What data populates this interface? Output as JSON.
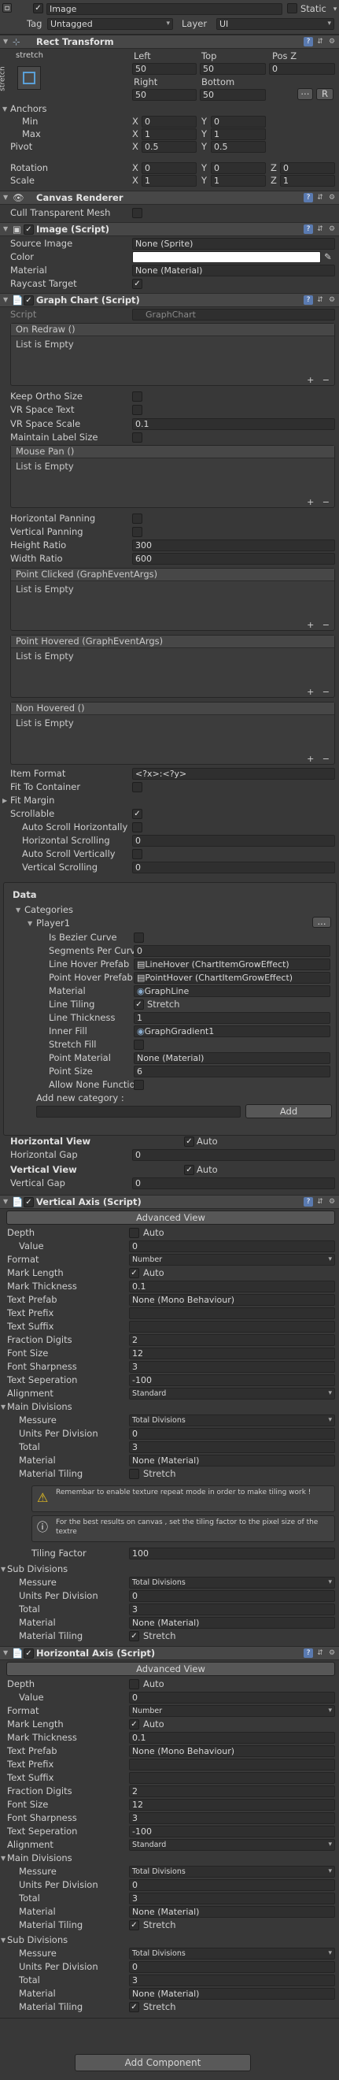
{
  "go": {
    "name": "Image",
    "static": "Static",
    "tag_label": "Tag",
    "tag": "Untagged",
    "layer_label": "Layer",
    "layer": "UI"
  },
  "rect": {
    "title": "Rect Transform",
    "stretch": "stretch",
    "left": "Left",
    "top": "Top",
    "posz": "Pos Z",
    "left_v": "50",
    "top_v": "50",
    "posz_v": "0",
    "right": "Right",
    "bottom": "Bottom",
    "right_v": "50",
    "bottom_v": "50",
    "r": "R",
    "anchors": "Anchors",
    "min": "Min",
    "max": "Max",
    "pivot": "Pivot",
    "x": "X",
    "y": "Y",
    "z": "Z",
    "min_x": "0",
    "min_y": "0",
    "max_x": "1",
    "max_y": "1",
    "piv_x": "0.5",
    "piv_y": "0.5",
    "rotation": "Rotation",
    "scale": "Scale",
    "rot_x": "0",
    "rot_y": "0",
    "rot_z": "0",
    "sc_x": "1",
    "sc_y": "1",
    "sc_z": "1"
  },
  "canvas": {
    "title": "Canvas Renderer",
    "cull": "Cull Transparent Mesh"
  },
  "image": {
    "title": "Image (Script)",
    "source": "Source Image",
    "source_v": "None (Sprite)",
    "color": "Color",
    "material": "Material",
    "material_v": "None (Material)",
    "raycast": "Raycast Target"
  },
  "graph": {
    "title": "Graph Chart (Script)",
    "script": "Script",
    "script_v": "GraphChart",
    "on_redraw": "On Redraw ()",
    "empty": "List is Empty",
    "keep_ortho": "Keep Ortho Size",
    "vr_text": "VR Space Text",
    "vr_scale": "VR Space Scale",
    "vr_scale_v": "0.1",
    "maintain": "Maintain Label Size",
    "mouse_pan": "Mouse Pan ()",
    "hpan": "Horizontal Panning",
    "vpan": "Vertical Panning",
    "height": "Height Ratio",
    "height_v": "300",
    "width": "Width Ratio",
    "width_v": "600",
    "point_clicked": "Point Clicked (GraphEventArgs)",
    "point_hovered": "Point Hovered (GraphEventArgs)",
    "non_hovered": "Non Hovered ()",
    "item_format": "Item Format",
    "item_format_v": "<?x>:<?y>",
    "fit_container": "Fit To Container",
    "fit_margin": "Fit Margin",
    "scrollable": "Scrollable",
    "auto_h": "Auto Scroll Horizontally",
    "h_scroll": "Horizontal Scrolling",
    "h_scroll_v": "0",
    "auto_v": "Auto Scroll Vertically",
    "v_scroll": "Vertical Scrolling",
    "v_scroll_v": "0",
    "data": "Data",
    "categories": "Categories",
    "player": "Player1",
    "more": "...",
    "bezier": "Is Bezier Curve",
    "segments": "Segments Per Curv",
    "segments_v": "0",
    "line_hover": "Line Hover Prefab",
    "line_hover_v": "LineHover (ChartItemGrowEffect)",
    "point_hover": "Point Hover Prefab",
    "point_hover_v": "PointHover (ChartItemGrowEffect)",
    "cat_material": "Material",
    "cat_material_v": "GraphLine",
    "line_tiling": "Line Tiling",
    "stretch": "Stretch",
    "line_thickness": "Line Thickness",
    "line_thickness_v": "1",
    "inner_fill": "Inner Fill",
    "inner_fill_v": "GraphGradient1",
    "stretch_fill": "Stretch Fill",
    "point_material": "Point Material",
    "point_material_v": "None (Material)",
    "point_size": "Point Size",
    "point_size_v": "6",
    "allow_none": "Allow None Function",
    "add_new": "Add new category :",
    "add": "Add",
    "hview": "Horizontal View",
    "auto": "Auto",
    "hgap": "Horizontal Gap",
    "hgap_v": "0",
    "vview": "Vertical View",
    "vgap": "Vertical Gap",
    "vgap_v": "0"
  },
  "axis": {
    "advanced": "Advanced View",
    "depth": "Depth",
    "value": "Value",
    "value_v": "0",
    "format": "Format",
    "format_v": "Number",
    "mark_length": "Mark Length",
    "mark_thickness": "Mark Thickness",
    "mark_thickness_v": "0.1",
    "text_prefab": "Text Prefab",
    "text_prefab_v": "None (Mono Behaviour)",
    "text_prefix": "Text Prefix",
    "text_suffix": "Text Suffix",
    "fraction": "Fraction Digits",
    "fraction_v": "2",
    "font_size": "Font Size",
    "font_size_v": "12",
    "sharpness": "Font Sharpness",
    "sharpness_v": "3",
    "separation": "Text Seperation",
    "separation_v": "-100",
    "alignment": "Alignment",
    "alignment_v": "Standard",
    "main_div": "Main Divisions",
    "sub_div": "Sub Divisions",
    "messure": "Messure",
    "messure_v": "Total Divisions",
    "units": "Units Per Division",
    "units_v": "0",
    "total": "Total",
    "total_v": "3",
    "material": "Material",
    "material_v": "None (Material)",
    "material_tiling": "Material Tiling",
    "stretch": "Stretch",
    "warn1": "Remembar to enable texture repeat mode in order to make tiling work !",
    "warn2": "For the best results on canvas , set the tiling factor to the pixel size of the textre",
    "tiling_factor": "Tiling Factor",
    "tiling_factor_v": "100"
  },
  "vaxis": {
    "title": "Vertical Axis (Script)"
  },
  "haxis": {
    "title": "Horizontal Axis (Script)"
  },
  "add_component": "Add Component",
  "colors": {
    "bg": "#383838",
    "header": "#474747",
    "field": "#2f2f2f"
  }
}
